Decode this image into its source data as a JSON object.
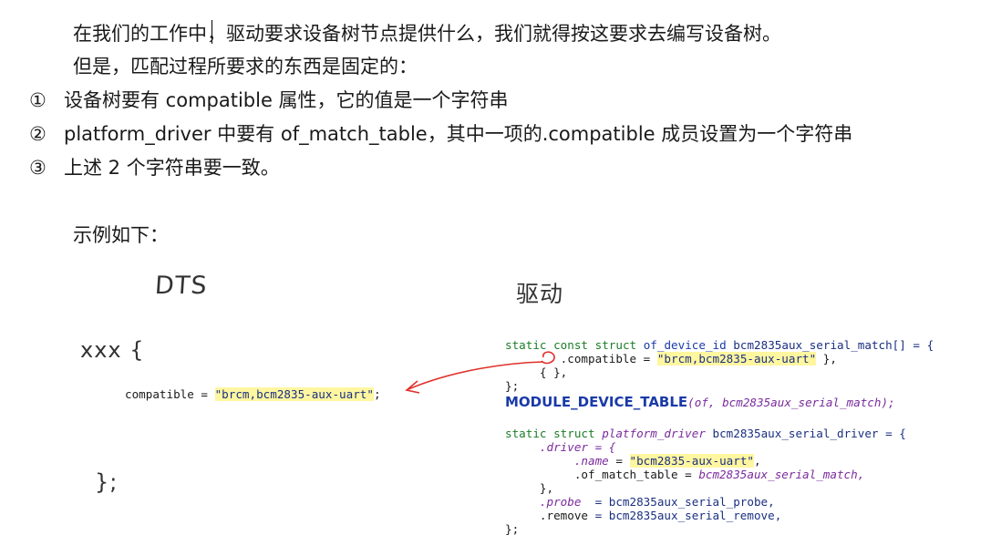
{
  "text": {
    "line1": "在我们的工作中，驱动要求设备树节点提供什么，我们就得按这要求去编写设备树。",
    "line2": "但是，匹配过程所要求的东西是固定的：",
    "items": [
      {
        "mark": "①",
        "text": "设备树要有 compatible 属性，它的值是一个字符串"
      },
      {
        "mark": "②",
        "text": "platform_driver 中要有 of_match_table，其中一项的.compatible 成员设置为一个字符串"
      },
      {
        "mark": "③",
        "text": "上述 2 个字符串要一致。"
      }
    ],
    "example": "示例如下："
  },
  "handwriting": {
    "dts_label": "DTS",
    "driver_label": "驱动",
    "node_open": "xxx {",
    "node_close": "};"
  },
  "dts_code": {
    "prop": "compatible",
    "eq": " = ",
    "value": "\"brcm,bcm2835-aux-uart\"",
    "end": ";"
  },
  "driver_code": {
    "l1_static": "static",
    "l1_const": "const",
    "l1_struct": "struct",
    "l1_type": "of_device_id",
    "l1_name": "bcm2835aux_serial_match[] = {",
    "l2_field": ".compatible = ",
    "l2_value": "\"brcm,bcm2835-aux-uart\"",
    "l2_end": " },",
    "l3": "{ },",
    "l4": "};",
    "l5_macro": "MODULE_DEVICE_TABLE",
    "l5_args": "(of, bcm2835aux_serial_match);",
    "l7_static": "static",
    "l7_struct": "struct",
    "l7_type": "platform_driver",
    "l7_name": "bcm2835aux_serial_driver = {",
    "l8": ".driver = {",
    "l9_field": ".name",
    "l9_eq": " = ",
    "l9_value": "\"bcm2835-aux-uart\"",
    "l9_end": ",",
    "l10_field": ".of_match_table = ",
    "l10_value": "bcm2835aux_serial_match,",
    "l11": "},",
    "l12_field": ".probe",
    "l12_value": "  = bcm2835aux_serial_probe,",
    "l13_field": ".remove",
    "l13_value": " = bcm2835aux_serial_remove,",
    "l14": "};"
  },
  "colors": {
    "keyword": "#1c7d28",
    "type": "#1a3aa8",
    "field": "#7a2b9c",
    "string_highlight": "#fff6a0",
    "arrow": "#e0302a"
  }
}
